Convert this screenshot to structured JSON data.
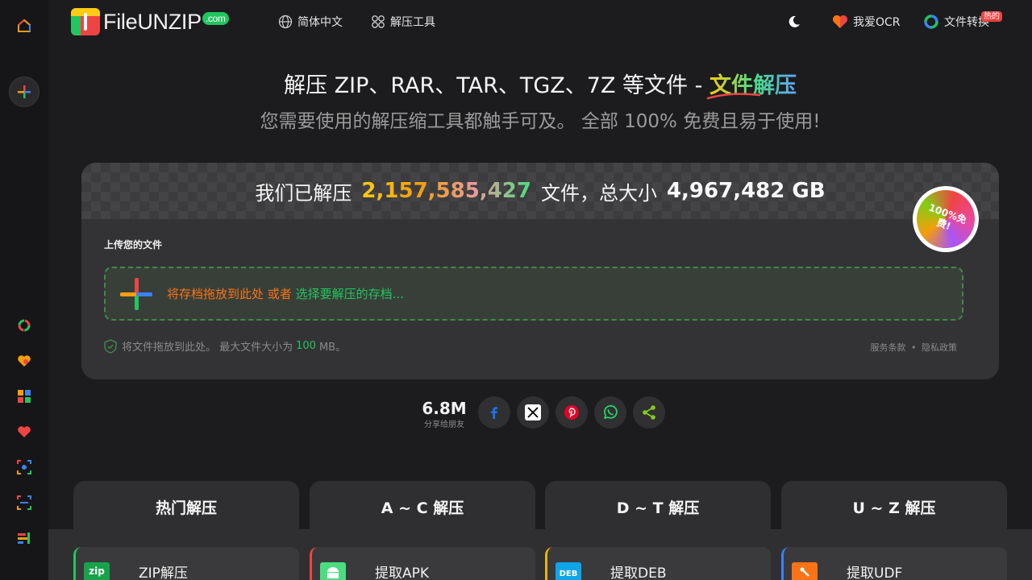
{
  "header": {
    "logo_text_plain": "File",
    "logo_text_accent": "UNZIP",
    "logo_suffix": ".com",
    "nav_language": "简体中文",
    "nav_tools": "解压工具",
    "nav_ocr": "我爱OCR",
    "nav_convert": "文件转换",
    "nav_convert_badge": "热的"
  },
  "hero": {
    "title_prefix": "解压 ZIP、RAR、TAR、TGZ、7Z 等文件 - ",
    "title_accent": "文件解压",
    "subtitle": "您需要使用的解压缩工具都触手可及。 全部 100% 免费且易于使用!"
  },
  "stats": {
    "prefix": "我们已解压",
    "file_count": "2,157,585,427",
    "middle": "文件，总大小",
    "total_size": "4,967,482 GB"
  },
  "upload": {
    "label": "上传您的文件",
    "drop_text": "将存档拖放到此处 或者",
    "select_text": "选择要解压的存档...",
    "info_prefix": "将文件拖放到此处。 最大文件大小为",
    "max_size": "100",
    "info_unit": "MB。",
    "terms": "服务条款",
    "separator": "•",
    "privacy": "隐私政策",
    "free_badge": "100%免费!"
  },
  "share": {
    "count": "6.8M",
    "label": "分享给朋友"
  },
  "tabs": [
    {
      "label": "热门解压"
    },
    {
      "label": "A ~ C 解压"
    },
    {
      "label": "D ~ T 解压"
    },
    {
      "label": "U ~ Z 解压"
    }
  ],
  "cards": [
    {
      "label": "ZIP解压",
      "icon_text": "zip",
      "color": "#16a34a"
    },
    {
      "label": "提取APK",
      "icon_text": "",
      "color": "#4ade80"
    },
    {
      "label": "提取DEB",
      "icon_text": "DEB",
      "color": "#0ea5e9"
    },
    {
      "label": "提取UDF",
      "icon_text": "",
      "color": "#f97316"
    }
  ],
  "card_borders": [
    "#22c55e",
    "#ef4444",
    "#eab308",
    "#3b82f6"
  ],
  "colors": {
    "accent_green": "#22c55e",
    "accent_orange": "#f97316",
    "background": "#1c1c1e"
  }
}
